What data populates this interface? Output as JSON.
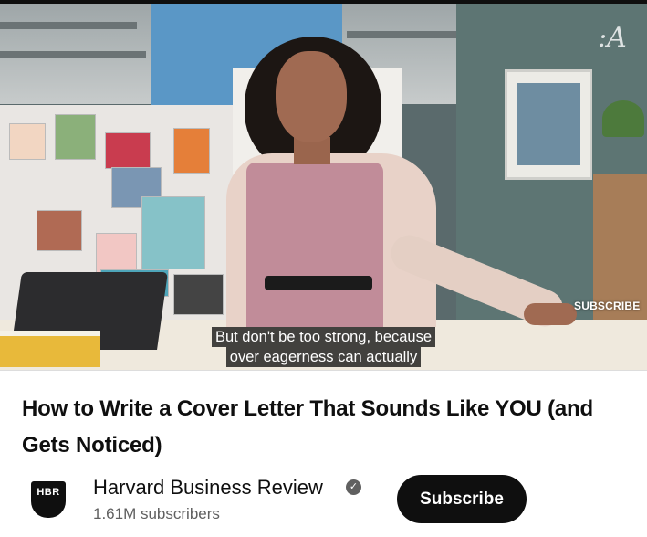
{
  "video": {
    "watermark": ":A",
    "overlay_subscribe": "SUBSCRIBE",
    "captions": [
      "But don't be too strong, because",
      "over eagerness can actually"
    ]
  },
  "title": "How to Write a Cover Letter That Sounds Like YOU (and Gets Noticed)",
  "channel": {
    "avatar_text": "HBR",
    "name": "Harvard Business Review",
    "verified_icon": "check-circle",
    "subscribers": "1.61M subscribers"
  },
  "subscribe_label": "Subscribe",
  "colors": {
    "text_primary": "#0f0f0f",
    "text_secondary": "#606060",
    "button_bg": "#0f0f0f",
    "button_text": "#ffffff"
  }
}
